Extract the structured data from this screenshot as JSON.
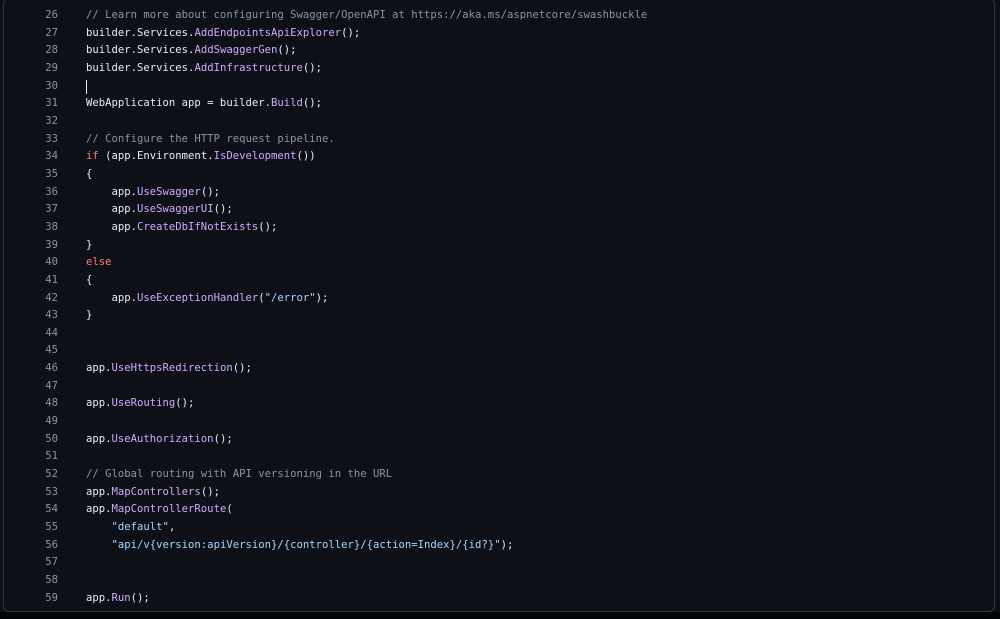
{
  "editor": {
    "lines": [
      {
        "n": "26",
        "tokens": [
          {
            "t": "// Learn more about configuring Swagger/OpenAPI at https://aka.ms/aspnetcore/swashbuckle",
            "c": "comment"
          }
        ]
      },
      {
        "n": "27",
        "tokens": [
          {
            "t": "builder.Services.",
            "c": "plain"
          },
          {
            "t": "AddEndpointsApiExplorer",
            "c": "method"
          },
          {
            "t": "();",
            "c": "plain"
          }
        ]
      },
      {
        "n": "28",
        "tokens": [
          {
            "t": "builder.Services.",
            "c": "plain"
          },
          {
            "t": "AddSwaggerGen",
            "c": "method"
          },
          {
            "t": "();",
            "c": "plain"
          }
        ]
      },
      {
        "n": "29",
        "tokens": [
          {
            "t": "builder.Services.",
            "c": "plain"
          },
          {
            "t": "AddInfrastructure",
            "c": "method"
          },
          {
            "t": "();",
            "c": "plain"
          }
        ]
      },
      {
        "n": "30",
        "tokens": [],
        "caret": true
      },
      {
        "n": "31",
        "tokens": [
          {
            "t": "WebApplication app = builder.",
            "c": "plain"
          },
          {
            "t": "Build",
            "c": "method"
          },
          {
            "t": "();",
            "c": "plain"
          }
        ]
      },
      {
        "n": "32",
        "tokens": []
      },
      {
        "n": "33",
        "tokens": [
          {
            "t": "// Configure the HTTP request pipeline.",
            "c": "comment"
          }
        ]
      },
      {
        "n": "34",
        "tokens": [
          {
            "t": "if",
            "c": "keyword"
          },
          {
            "t": " (app.Environment.",
            "c": "plain"
          },
          {
            "t": "IsDevelopment",
            "c": "method"
          },
          {
            "t": "())",
            "c": "plain"
          }
        ]
      },
      {
        "n": "35",
        "tokens": [
          {
            "t": "{",
            "c": "plain"
          }
        ]
      },
      {
        "n": "36",
        "tokens": [
          {
            "t": "    app.",
            "c": "plain"
          },
          {
            "t": "UseSwagger",
            "c": "method"
          },
          {
            "t": "();",
            "c": "plain"
          }
        ]
      },
      {
        "n": "37",
        "tokens": [
          {
            "t": "    app.",
            "c": "plain"
          },
          {
            "t": "UseSwaggerUI",
            "c": "method"
          },
          {
            "t": "();",
            "c": "plain"
          }
        ]
      },
      {
        "n": "38",
        "tokens": [
          {
            "t": "    app.",
            "c": "plain"
          },
          {
            "t": "CreateDbIfNotExists",
            "c": "method"
          },
          {
            "t": "();",
            "c": "plain"
          }
        ]
      },
      {
        "n": "39",
        "tokens": [
          {
            "t": "}",
            "c": "plain"
          }
        ]
      },
      {
        "n": "40",
        "tokens": [
          {
            "t": "else",
            "c": "keyword"
          }
        ]
      },
      {
        "n": "41",
        "tokens": [
          {
            "t": "{",
            "c": "plain"
          }
        ]
      },
      {
        "n": "42",
        "tokens": [
          {
            "t": "    app.",
            "c": "plain"
          },
          {
            "t": "UseExceptionHandler",
            "c": "method"
          },
          {
            "t": "(",
            "c": "plain"
          },
          {
            "t": "\"/error\"",
            "c": "string"
          },
          {
            "t": ");",
            "c": "plain"
          }
        ]
      },
      {
        "n": "43",
        "tokens": [
          {
            "t": "}",
            "c": "plain"
          }
        ]
      },
      {
        "n": "44",
        "tokens": []
      },
      {
        "n": "45",
        "tokens": []
      },
      {
        "n": "46",
        "tokens": [
          {
            "t": "app.",
            "c": "plain"
          },
          {
            "t": "UseHttpsRedirection",
            "c": "method"
          },
          {
            "t": "();",
            "c": "plain"
          }
        ]
      },
      {
        "n": "47",
        "tokens": []
      },
      {
        "n": "48",
        "tokens": [
          {
            "t": "app.",
            "c": "plain"
          },
          {
            "t": "UseRouting",
            "c": "method"
          },
          {
            "t": "();",
            "c": "plain"
          }
        ]
      },
      {
        "n": "49",
        "tokens": []
      },
      {
        "n": "50",
        "tokens": [
          {
            "t": "app.",
            "c": "plain"
          },
          {
            "t": "UseAuthorization",
            "c": "method"
          },
          {
            "t": "();",
            "c": "plain"
          }
        ]
      },
      {
        "n": "51",
        "tokens": []
      },
      {
        "n": "52",
        "tokens": [
          {
            "t": "// Global routing with API versioning in the URL",
            "c": "comment"
          }
        ]
      },
      {
        "n": "53",
        "tokens": [
          {
            "t": "app.",
            "c": "plain"
          },
          {
            "t": "MapControllers",
            "c": "method"
          },
          {
            "t": "();",
            "c": "plain"
          }
        ]
      },
      {
        "n": "54",
        "tokens": [
          {
            "t": "app.",
            "c": "plain"
          },
          {
            "t": "MapControllerRoute",
            "c": "method"
          },
          {
            "t": "(",
            "c": "plain"
          }
        ]
      },
      {
        "n": "55",
        "tokens": [
          {
            "t": "    ",
            "c": "plain"
          },
          {
            "t": "\"default\"",
            "c": "string"
          },
          {
            "t": ",",
            "c": "plain"
          }
        ]
      },
      {
        "n": "56",
        "tokens": [
          {
            "t": "    ",
            "c": "plain"
          },
          {
            "t": "\"api/v{version:apiVersion}/{controller}/{action=Index}/{id?}\"",
            "c": "string"
          },
          {
            "t": ");",
            "c": "plain"
          }
        ]
      },
      {
        "n": "57",
        "tokens": []
      },
      {
        "n": "58",
        "tokens": []
      },
      {
        "n": "59",
        "tokens": [
          {
            "t": "app.",
            "c": "plain"
          },
          {
            "t": "Run",
            "c": "method"
          },
          {
            "t": "();",
            "c": "plain"
          }
        ]
      }
    ]
  },
  "colors": {
    "background": "#0d1117",
    "border": "#30363d",
    "comment": "#8b949e",
    "keyword": "#ff7b72",
    "method": "#d2a8ff",
    "string": "#a5d6ff",
    "plain": "#e6edf3"
  }
}
